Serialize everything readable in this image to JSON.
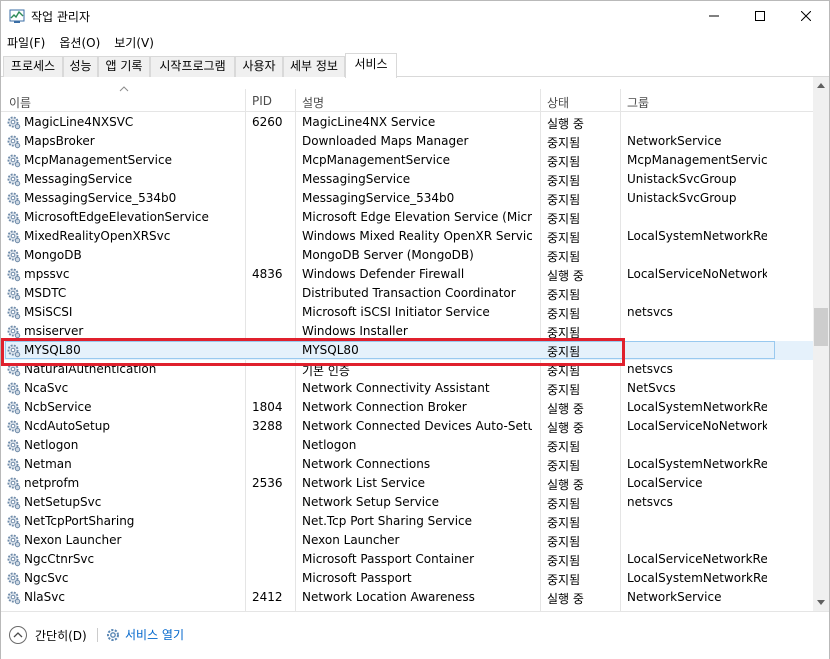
{
  "window": {
    "title": "작업 관리자"
  },
  "menu": [
    "파일(F)",
    "옵션(O)",
    "보기(V)"
  ],
  "tabs": [
    "프로세스",
    "성능",
    "앱 기록",
    "시작프로그램",
    "사용자",
    "세부 정보",
    "서비스"
  ],
  "active_tab": "서비스",
  "columns": {
    "name": "이름",
    "pid": "PID",
    "desc": "설명",
    "status": "상태",
    "group": "그룹"
  },
  "rows": [
    {
      "name": "MagicLine4NXSVC",
      "pid": "6260",
      "desc": "MagicLine4NX Service",
      "status": "실행 중",
      "group": ""
    },
    {
      "name": "MapsBroker",
      "pid": "",
      "desc": "Downloaded Maps Manager",
      "status": "중지됨",
      "group": "NetworkService"
    },
    {
      "name": "McpManagementService",
      "pid": "",
      "desc": "McpManagementService",
      "status": "중지됨",
      "group": "McpManagementServic..."
    },
    {
      "name": "MessagingService",
      "pid": "",
      "desc": "MessagingService",
      "status": "중지됨",
      "group": "UnistackSvcGroup"
    },
    {
      "name": "MessagingService_534b0",
      "pid": "",
      "desc": "MessagingService_534b0",
      "status": "중지됨",
      "group": "UnistackSvcGroup"
    },
    {
      "name": "MicrosoftEdgeElevationService",
      "pid": "",
      "desc": "Microsoft Edge Elevation Service (Micros...",
      "status": "중지됨",
      "group": ""
    },
    {
      "name": "MixedRealityOpenXRSvc",
      "pid": "",
      "desc": "Windows Mixed Reality OpenXR Service",
      "status": "중지됨",
      "group": "LocalSystemNetworkRes..."
    },
    {
      "name": "MongoDB",
      "pid": "",
      "desc": "MongoDB Server (MongoDB)",
      "status": "중지됨",
      "group": ""
    },
    {
      "name": "mpssvc",
      "pid": "4836",
      "desc": "Windows Defender Firewall",
      "status": "실행 중",
      "group": "LocalServiceNoNetwork..."
    },
    {
      "name": "MSDTC",
      "pid": "",
      "desc": "Distributed Transaction Coordinator",
      "status": "중지됨",
      "group": ""
    },
    {
      "name": "MSiSCSI",
      "pid": "",
      "desc": "Microsoft iSCSI Initiator Service",
      "status": "중지됨",
      "group": "netsvcs"
    },
    {
      "name": "msiserver",
      "pid": "",
      "desc": "Windows Installer",
      "status": "중지됨",
      "group": ""
    },
    {
      "name": "MYSQL80",
      "pid": "",
      "desc": "MYSQL80",
      "status": "중지됨",
      "group": ""
    },
    {
      "name": "NaturalAuthentication",
      "pid": "",
      "desc": "기본 인증",
      "status": "중지됨",
      "group": "netsvcs"
    },
    {
      "name": "NcaSvc",
      "pid": "",
      "desc": "Network Connectivity Assistant",
      "status": "중지됨",
      "group": "NetSvcs"
    },
    {
      "name": "NcbService",
      "pid": "1804",
      "desc": "Network Connection Broker",
      "status": "실행 중",
      "group": "LocalSystemNetworkRes..."
    },
    {
      "name": "NcdAutoSetup",
      "pid": "3288",
      "desc": "Network Connected Devices Auto-Setup",
      "status": "실행 중",
      "group": "LocalServiceNoNetwork"
    },
    {
      "name": "Netlogon",
      "pid": "",
      "desc": "Netlogon",
      "status": "중지됨",
      "group": ""
    },
    {
      "name": "Netman",
      "pid": "",
      "desc": "Network Connections",
      "status": "중지됨",
      "group": "LocalSystemNetworkRes..."
    },
    {
      "name": "netprofm",
      "pid": "2536",
      "desc": "Network List Service",
      "status": "실행 중",
      "group": "LocalService"
    },
    {
      "name": "NetSetupSvc",
      "pid": "",
      "desc": "Network Setup Service",
      "status": "중지됨",
      "group": "netsvcs"
    },
    {
      "name": "NetTcpPortSharing",
      "pid": "",
      "desc": "Net.Tcp Port Sharing Service",
      "status": "중지됨",
      "group": ""
    },
    {
      "name": "Nexon Launcher",
      "pid": "",
      "desc": "Nexon Launcher",
      "status": "중지됨",
      "group": ""
    },
    {
      "name": "NgcCtnrSvc",
      "pid": "",
      "desc": "Microsoft Passport Container",
      "status": "중지됨",
      "group": "LocalServiceNetworkRes..."
    },
    {
      "name": "NgcSvc",
      "pid": "",
      "desc": "Microsoft Passport",
      "status": "중지됨",
      "group": "LocalSystemNetworkRes..."
    },
    {
      "name": "NlaSvc",
      "pid": "2412",
      "desc": "Network Location Awareness",
      "status": "실행 중",
      "group": "NetworkService"
    }
  ],
  "selected_row": "MYSQL80",
  "footer": {
    "less_label": "간단히(D)",
    "open_services_label": "서비스 열기"
  },
  "colors": {
    "highlight": "#e0202d",
    "selection": "#e5f1fb",
    "link": "#0066cc"
  }
}
